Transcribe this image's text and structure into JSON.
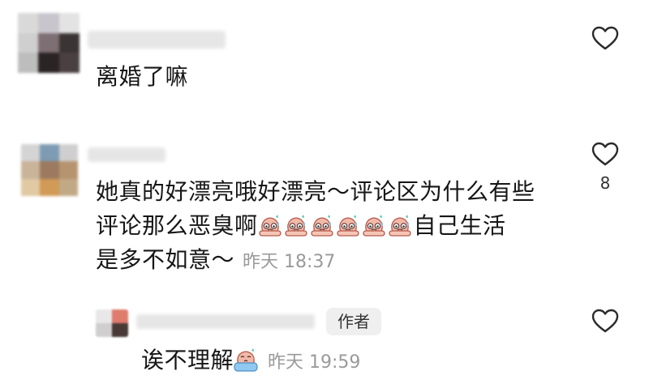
{
  "comments": [
    {
      "text": "离婚了嘛",
      "meta": "",
      "like_count": ""
    },
    {
      "text_line1": "她真的好漂亮哦好漂亮～评论区为什么有些",
      "text_line2a": "评论那么恶臭啊",
      "text_line2b": "自己生活",
      "text_line3": "是多不如意～",
      "timestamp": "昨天 18:37",
      "like_count": "8"
    }
  ],
  "reply": {
    "author_badge": "作者",
    "text": "诶不理解",
    "timestamp": "昨天 19:59"
  },
  "icons": {
    "like": "heart-outline-icon",
    "emoji": "sweat-blush-emoji-icon",
    "reply_emoji": "crying-emoji-icon"
  },
  "colors": {
    "text": "#161616",
    "meta": "#9a9a9a",
    "badge_bg": "#efefef",
    "heart_stroke": "#2a2a2a"
  }
}
